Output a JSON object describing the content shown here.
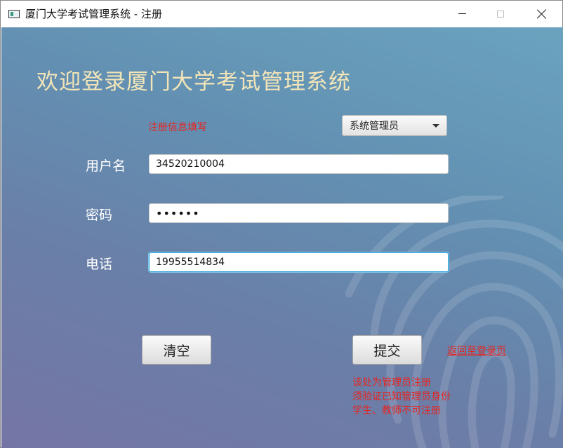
{
  "window": {
    "title": "厦门大学考试管理系统 - 注册",
    "controls": {
      "minimize": "minimize-icon",
      "maximize": "maximize-icon",
      "close": "close-icon"
    }
  },
  "page": {
    "welcome": "欢迎登录厦门大学考试管理系统",
    "hint": "注册信息填写",
    "role": {
      "selected": "系统管理员"
    }
  },
  "form": {
    "username_label": "用户名",
    "username_value": "34520210004",
    "password_label": "密码",
    "password_value": "••••••",
    "phone_label": "电话",
    "phone_value": "19955514834"
  },
  "actions": {
    "clear_label": "清空",
    "submit_label": "提交",
    "back_link": "返回至登录页"
  },
  "notes": [
    "该处为管理员注册",
    "须验证已知管理员身份",
    "学生、教师不可注册"
  ],
  "colors": {
    "accent_red": "#e8231d",
    "welcome_text": "#f3e5b8",
    "focus_blue": "#2a9fd6"
  }
}
